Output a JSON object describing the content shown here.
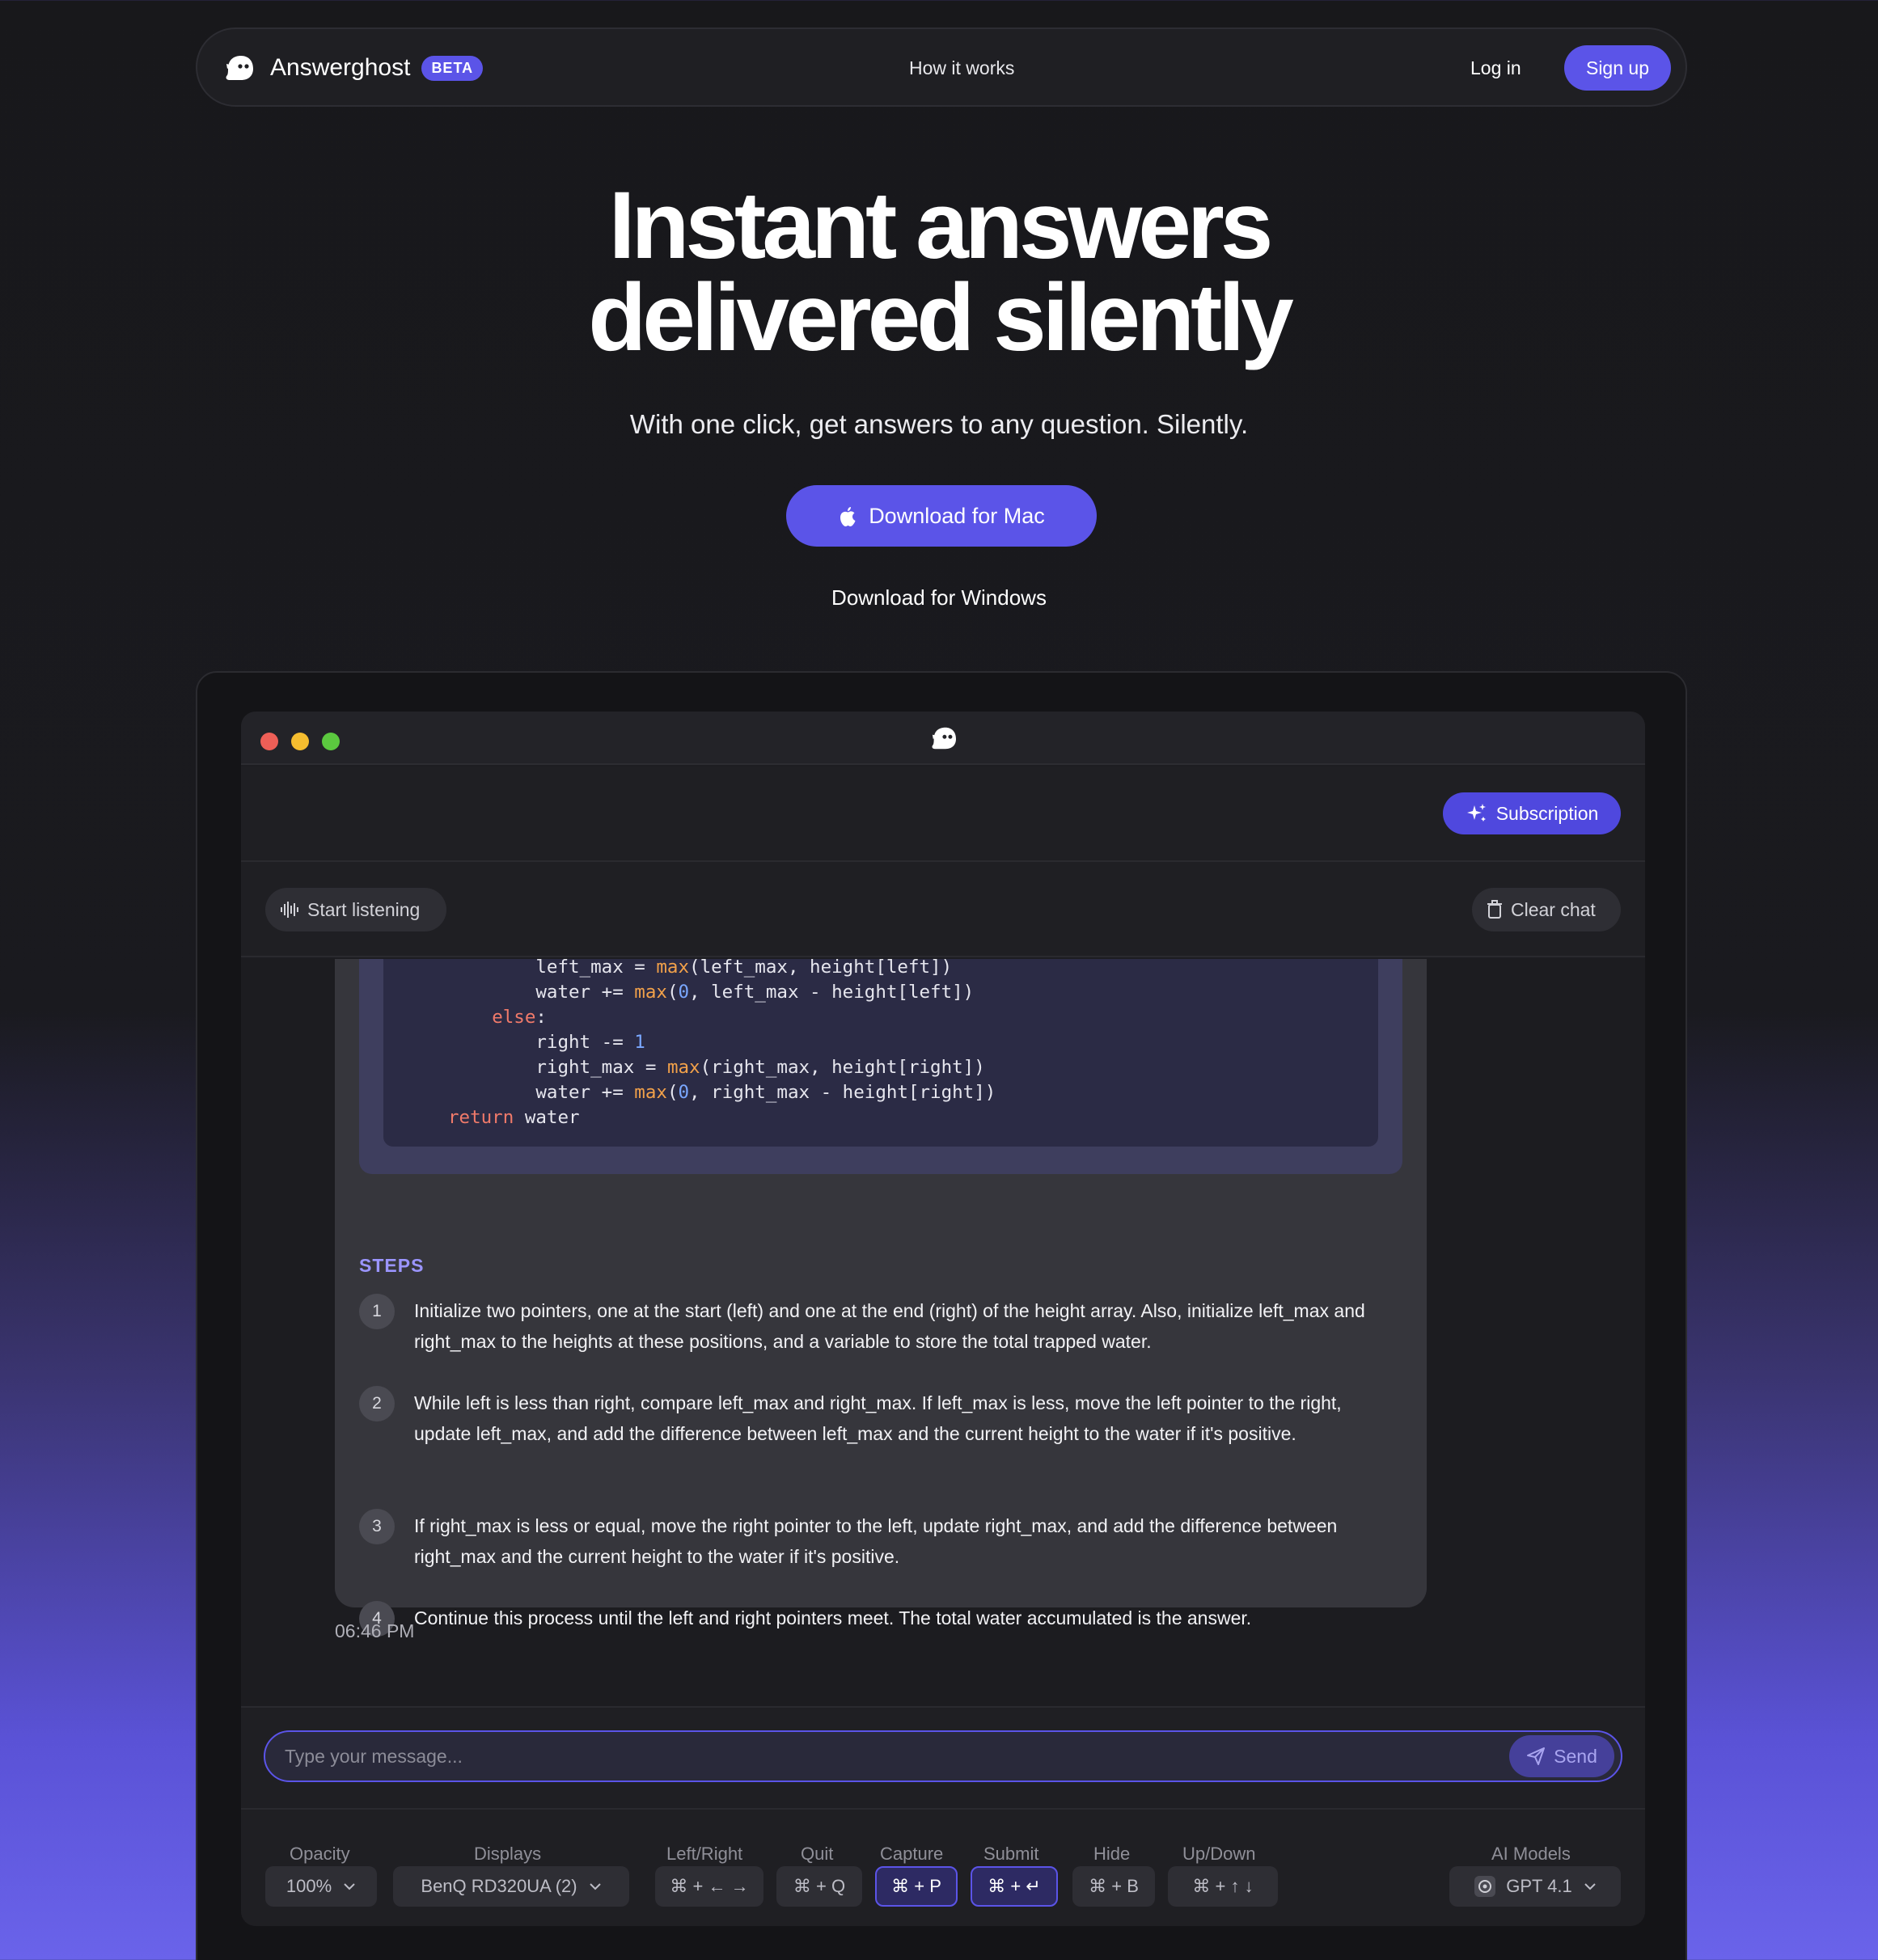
{
  "nav": {
    "brand": "Answerghost",
    "badge": "BETA",
    "how_it_works": "How it works",
    "login": "Log in",
    "signup": "Sign up"
  },
  "hero": {
    "title_line1": "Instant answers",
    "title_line2": "delivered silently",
    "subtitle": "With one click, get answers to any question. Silently.",
    "download_mac": "Download for Mac",
    "download_windows": "Download for Windows"
  },
  "app": {
    "subscription": "Subscription",
    "start_listening": "Start listening",
    "clear_chat": "Clear chat",
    "code_lines": [
      "        left_max = max(left_max, height[left])",
      "        water += max(0, left_max - height[left])",
      "    else:",
      "        right -= 1",
      "        right_max = max(right_max, height[right])",
      "        water += max(0, right_max - height[right])",
      "return water"
    ],
    "steps_heading": "STEPS",
    "steps": [
      {
        "num": "1",
        "text": "Initialize two pointers, one at the start (left) and one at the end (right) of the height array. Also, initialize left_max and right_max to the heights at these positions, and a variable to store the total trapped water."
      },
      {
        "num": "2",
        "text": "While left is less than right, compare left_max and right_max. If left_max is less, move the left pointer to the right, update left_max, and add the difference between left_max and the current height to the water if it's positive."
      },
      {
        "num": "3",
        "text": "If right_max is less or equal, move the right pointer to the left, update right_max, and add the difference between right_max and the current height to the water if it's positive."
      },
      {
        "num": "4",
        "text": "Continue this process until the left and right pointers meet. The total water accumulated is the answer."
      }
    ],
    "timestamp": "06:46 PM",
    "input_placeholder": "Type your message...",
    "send": "Send",
    "controls": {
      "opacity_label": "Opacity",
      "opacity_value": "100%",
      "displays_label": "Displays",
      "displays_value": "BenQ RD320UA (2)",
      "leftright_label": "Left/Right",
      "leftright_keys": "⌘ + ← →",
      "quit_label": "Quit",
      "quit_keys": "⌘ + Q",
      "capture_label": "Capture",
      "capture_keys": "⌘ + P",
      "submit_label": "Submit",
      "submit_keys": "⌘ + ↵",
      "hide_label": "Hide",
      "hide_keys": "⌘ + B",
      "updown_label": "Up/Down",
      "updown_keys": "⌘ + ↑ ↓",
      "models_label": "AI Models",
      "models_value": "GPT 4.1"
    }
  },
  "colors": {
    "accent": "#5b54e8",
    "background": "#18181b",
    "traffic_red": "#ee5f57",
    "traffic_yellow": "#f5bd2f",
    "traffic_green": "#5bc83f"
  }
}
